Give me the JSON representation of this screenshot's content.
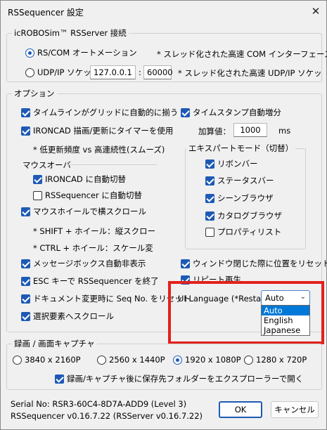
{
  "window": {
    "title": "RSSequencer 設定",
    "close_glyph": "✕"
  },
  "server": {
    "legend": "icROBOSim™ RSServer 接続",
    "rs_com_label": "RS/COM オートメーション",
    "rs_com_note": "* スレッド化された高速 COM インターフェース",
    "udp_label": "UDP/IP ソケット",
    "ip": "127.0.0.1",
    "colon": ":",
    "port": "60000",
    "udp_note": "* スレッド化された高速 UDP/IP ソケッ"
  },
  "options": {
    "legend": "オプション",
    "snap_timeline": "タイムラインがグリッドに自動的に揃う",
    "ironcad_timer": "IRONCAD 描画/更新にタイマーを使用",
    "timer_note": "* 低更新頻度 vs 高連続性(スムーズ)",
    "mouseover_heading": "マウスオーバー",
    "auto_ironcad": "IRONCAD に自動切替",
    "auto_rsseq": "RSSequencer に自動切替",
    "wheel_hscroll": "マウスホイールで横スクロール",
    "shift_note": "* SHIFT + ホイール：縦スクロー",
    "ctrl_note": "* CTRL + ホイール：スケール変",
    "msgbox_hide": "メッセージボックス自動非表示",
    "esc_quit": "ESC キーで RSSequencer を終了",
    "doc_reset": "ドキュメント変更時に Seq No. をリセット",
    "select_scroll": "選択要素へスクロール",
    "timestamp_inc": "タイムスタンプ自動増分",
    "add_value_label": "加算値：",
    "add_value": "1000",
    "add_unit": "ms",
    "expert_legend": "エキスパートモード（切替）",
    "expert_items": [
      "リボンバー",
      "ステータスバー",
      "シーンブラウザ",
      "カタログブラウザ",
      "プロパティリスト"
    ],
    "reset_window": "ウィンドウ閉じた際に位置をリセット",
    "repeat_play": "リピート再生",
    "ui_lang_label": "UI Language (*Restart):",
    "ui_lang_value": "Auto",
    "ui_lang_options": [
      "Auto",
      "English",
      "Japanese"
    ]
  },
  "capture": {
    "legend": "録画 / 画面キャプチャ",
    "res": [
      "3840 x 2160P",
      "2560 x 1440P",
      "1920 x 1080P",
      "1280 x 720P"
    ],
    "open_folder": "録画/キャプチャ後に保存先フォルダーをエクスプローラーで開く"
  },
  "footer": {
    "serial": "Serial No: RSR3-60C4-8D7A-ADD9 (Level 3)",
    "version": "RSSequencer v0.16.7.22 (RSServer v0.16.7.22)",
    "ok": "OK",
    "cancel": "キャンセル"
  },
  "colors": {
    "accent": "#1d5ab5",
    "highlight": "#e2211c",
    "selection": "#0078d7"
  }
}
